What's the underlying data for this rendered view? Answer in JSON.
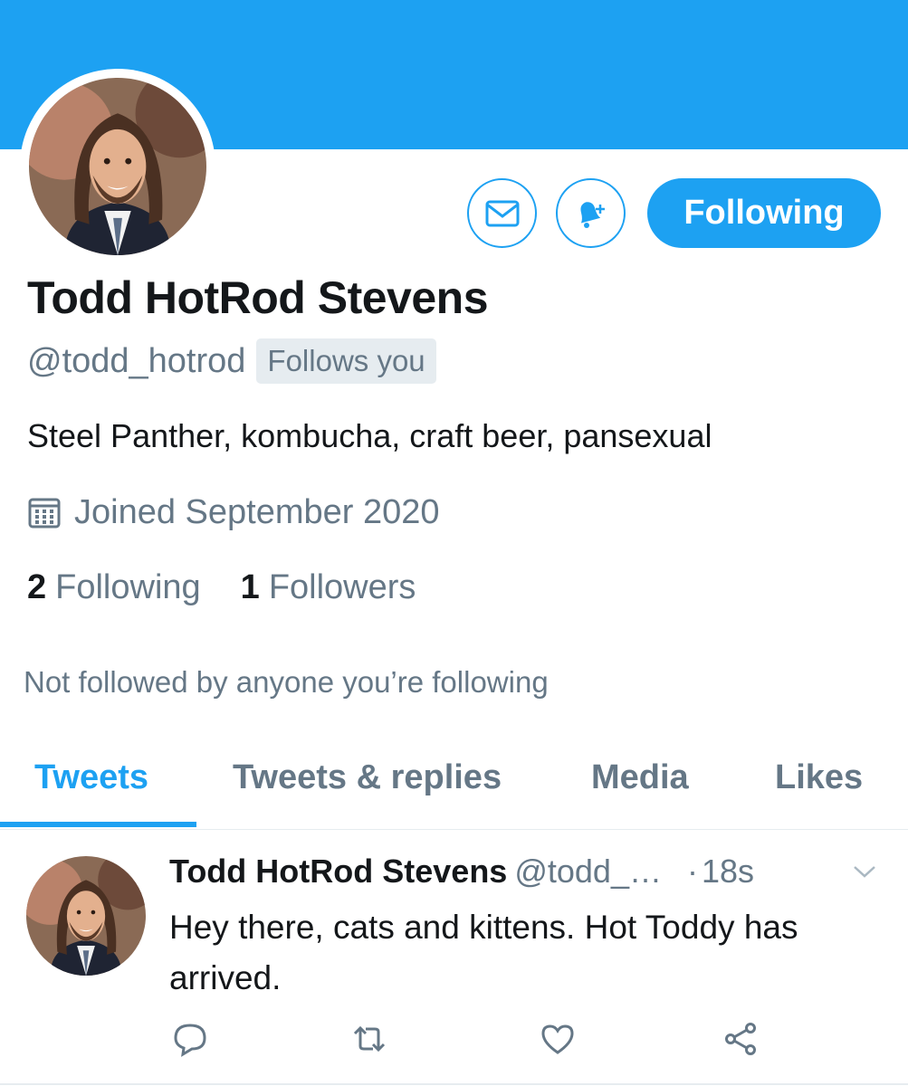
{
  "colors": {
    "accent": "#1da1f2",
    "secondary_text": "#657786",
    "primary_text": "#14171a"
  },
  "profile": {
    "name": "Todd HotRod Stevens",
    "handle": "@todd_hotrod",
    "follows_you_badge": "Follows you",
    "bio": "Steel Panther, kombucha, craft beer, pansexual",
    "joined": "Joined September 2020",
    "joined_icon": "calendar-icon",
    "following_count": "2",
    "following_label": "Following",
    "followers_count": "1",
    "followers_label": "Followers",
    "mutuals_note": "Not followed by anyone you’re following"
  },
  "actions": {
    "message_icon": "envelope-icon",
    "notify_icon": "bell-plus-icon",
    "follow_button_label": "Following"
  },
  "tabs": [
    {
      "label": "Tweets",
      "active": true
    },
    {
      "label": "Tweets & replies",
      "active": false
    },
    {
      "label": "Media",
      "active": false
    },
    {
      "label": "Likes",
      "active": false
    }
  ],
  "tweet": {
    "author_name": "Todd HotRod Stevens",
    "author_handle": "@todd_…",
    "dot": "·",
    "time": "18s",
    "text": "Hey there, cats and kittens. Hot Toddy has arrived.",
    "action_icons": [
      "reply-icon",
      "retweet-icon",
      "like-icon",
      "share-icon"
    ]
  }
}
